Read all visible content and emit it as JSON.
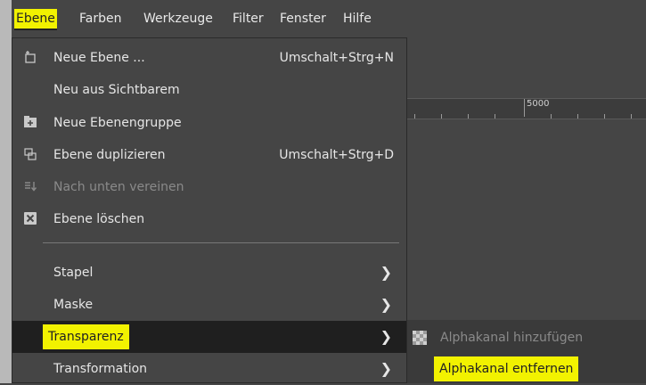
{
  "menubar": {
    "items": [
      {
        "label": "Ebene",
        "active": true
      },
      {
        "label": "Farben"
      },
      {
        "label": "Werkzeuge"
      },
      {
        "label": "Filter"
      },
      {
        "label": "Fenster"
      },
      {
        "label": "Hilfe"
      }
    ]
  },
  "ruler": {
    "label": "5000"
  },
  "menu": {
    "items": [
      {
        "label": "Neue Ebene ...",
        "shortcut": "Umschalt+Strg+N",
        "icon": "new-layer-icon"
      },
      {
        "label": "Neu aus Sichtbarem",
        "icon": ""
      },
      {
        "label": "Neue Ebenengruppe",
        "icon": "new-layer-group-icon"
      },
      {
        "label": "Ebene duplizieren",
        "shortcut": "Umschalt+Strg+D",
        "icon": "duplicate-layer-icon"
      },
      {
        "label": "Nach unten vereinen",
        "disabled": true,
        "icon": "merge-down-icon"
      },
      {
        "label": "Ebene löschen",
        "icon": "delete-layer-icon"
      },
      {
        "label": "Stapel",
        "submenu": true
      },
      {
        "label": "Maske",
        "submenu": true
      },
      {
        "label": "Transparenz",
        "submenu": true,
        "selected": true
      },
      {
        "label": "Transformation",
        "submenu": true
      }
    ]
  },
  "submenu": {
    "items": [
      {
        "label": "Alphakanal hinzufügen",
        "disabled": true,
        "icon": "checkerboard-icon"
      },
      {
        "label": "Alphakanal entfernen",
        "highlight": true
      }
    ]
  },
  "colors": {
    "highlight": "#f2f200",
    "menu_bg": "#454545",
    "selected_bg": "#1f1f1f"
  }
}
